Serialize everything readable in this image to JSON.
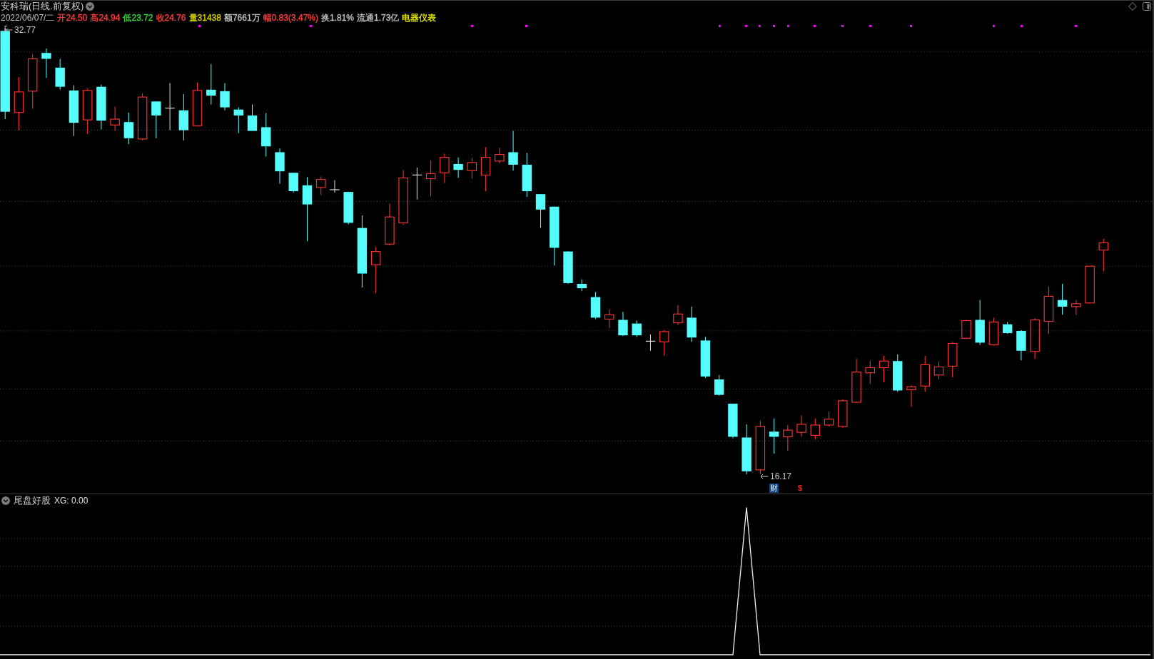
{
  "title_bar": {
    "title": "安科瑞(日线.前复权)"
  },
  "quote_bar": {
    "date": "2022/06/07/二",
    "fields": [
      {
        "text": "开24.50",
        "color": "#ff3c3c"
      },
      {
        "text": "高24.94",
        "color": "#ff3c3c"
      },
      {
        "text": "低23.72",
        "color": "#3cd23c"
      },
      {
        "text": "收24.76",
        "color": "#ff3c3c"
      },
      {
        "text": "量31438",
        "color": "#d2d200"
      },
      {
        "text": "额7661万",
        "color": "#c0c0c0"
      },
      {
        "text": "幅0.83(3.47%)",
        "color": "#ff3c3c"
      },
      {
        "text": "换1.81%",
        "color": "#c0c0c0"
      },
      {
        "text": "流通1.73亿",
        "color": "#c0c0c0"
      },
      {
        "text": "电器仪表",
        "color": "#e6e600"
      }
    ]
  },
  "price_chart": {
    "high_label": "32.77",
    "low_label": "16.17",
    "markers": [
      {
        "kind": "finance",
        "text": "财"
      },
      {
        "kind": "dividend",
        "text": "$"
      }
    ]
  },
  "indicator": {
    "name": "尾盘好股",
    "reading": "XG: 0.00"
  }
}
